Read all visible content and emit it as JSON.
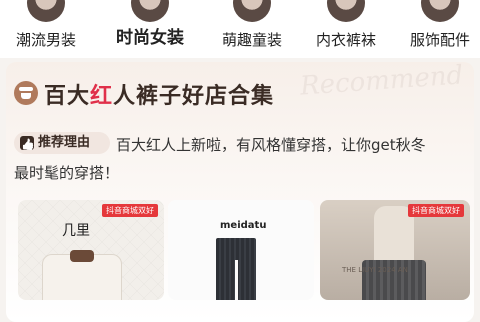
{
  "categories": [
    {
      "label": "潮流男装",
      "active": false
    },
    {
      "label": "时尚女装",
      "active": true
    },
    {
      "label": "萌趣童装",
      "active": false
    },
    {
      "label": "内衣裤袜",
      "active": false
    },
    {
      "label": "服饰配件",
      "active": false
    }
  ],
  "store_section": {
    "title_prefix": "百大",
    "title_highlight": "红",
    "title_suffix": "人裤子好店合集",
    "watermark": "Recommend",
    "reason_badge": "推荐理由",
    "reason_line1": "百大红人上新啦，有风格懂穿搭，让你get秋冬",
    "reason_line2": "最时髦的穿搭！"
  },
  "products": [
    {
      "promo": "抖音商城双好",
      "brand": "几里"
    },
    {
      "promo": "",
      "brand": "meidatu"
    },
    {
      "promo": "抖音商城双好",
      "brand": "THE LIUYI 2024 AN"
    }
  ],
  "colors": {
    "accent_red": "#e0304a",
    "promo_red": "#e5383b"
  }
}
